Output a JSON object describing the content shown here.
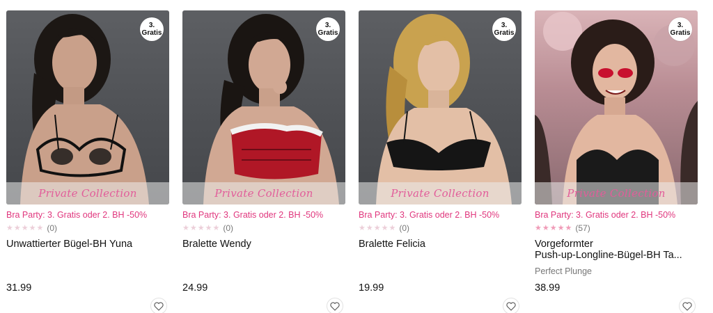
{
  "products": [
    {
      "badge": {
        "line1": "3.",
        "line2": "Gratis"
      },
      "collection_label": "Private Collection",
      "promo": "Bra Party: 3. Gratis oder 2. BH -50%",
      "rating": {
        "stars": 0,
        "max": 5,
        "count": "(0)"
      },
      "title": "Unwattierter Bügel-BH Yuna",
      "subtitle": "",
      "price": "31.99"
    },
    {
      "badge": {
        "line1": "3.",
        "line2": "Gratis"
      },
      "collection_label": "Private Collection",
      "promo": "Bra Party: 3. Gratis oder 2. BH -50%",
      "rating": {
        "stars": 0,
        "max": 5,
        "count": "(0)"
      },
      "title": "Bralette Wendy",
      "subtitle": "",
      "price": "24.99"
    },
    {
      "badge": {
        "line1": "3.",
        "line2": "Gratis"
      },
      "collection_label": "Private Collection",
      "promo": "Bra Party: 3. Gratis oder 2. BH -50%",
      "rating": {
        "stars": 0,
        "max": 5,
        "count": "(0)"
      },
      "title": "Bralette Felicia",
      "subtitle": "",
      "price": "19.99"
    },
    {
      "badge": {
        "line1": "3.",
        "line2": "Gratis"
      },
      "collection_label": "Private Collection",
      "promo": "Bra Party: 3. Gratis oder 2. BH -50%",
      "rating": {
        "stars": 5,
        "max": 5,
        "count": "(57)"
      },
      "title_line1": "Vorgeformter",
      "title_line2": "Push-up-Longline-Bügel-BH Ta...",
      "subtitle": "Perfect Plunge",
      "price": "38.99"
    }
  ],
  "colors": {
    "promo": "#e0367d",
    "star_empty": "#eccfd9",
    "star_full": "#f09cb8",
    "collection_text": "#e25d9a"
  },
  "icons": {
    "wishlist": "heart-outline-icon",
    "rating_star": "star-icon"
  }
}
